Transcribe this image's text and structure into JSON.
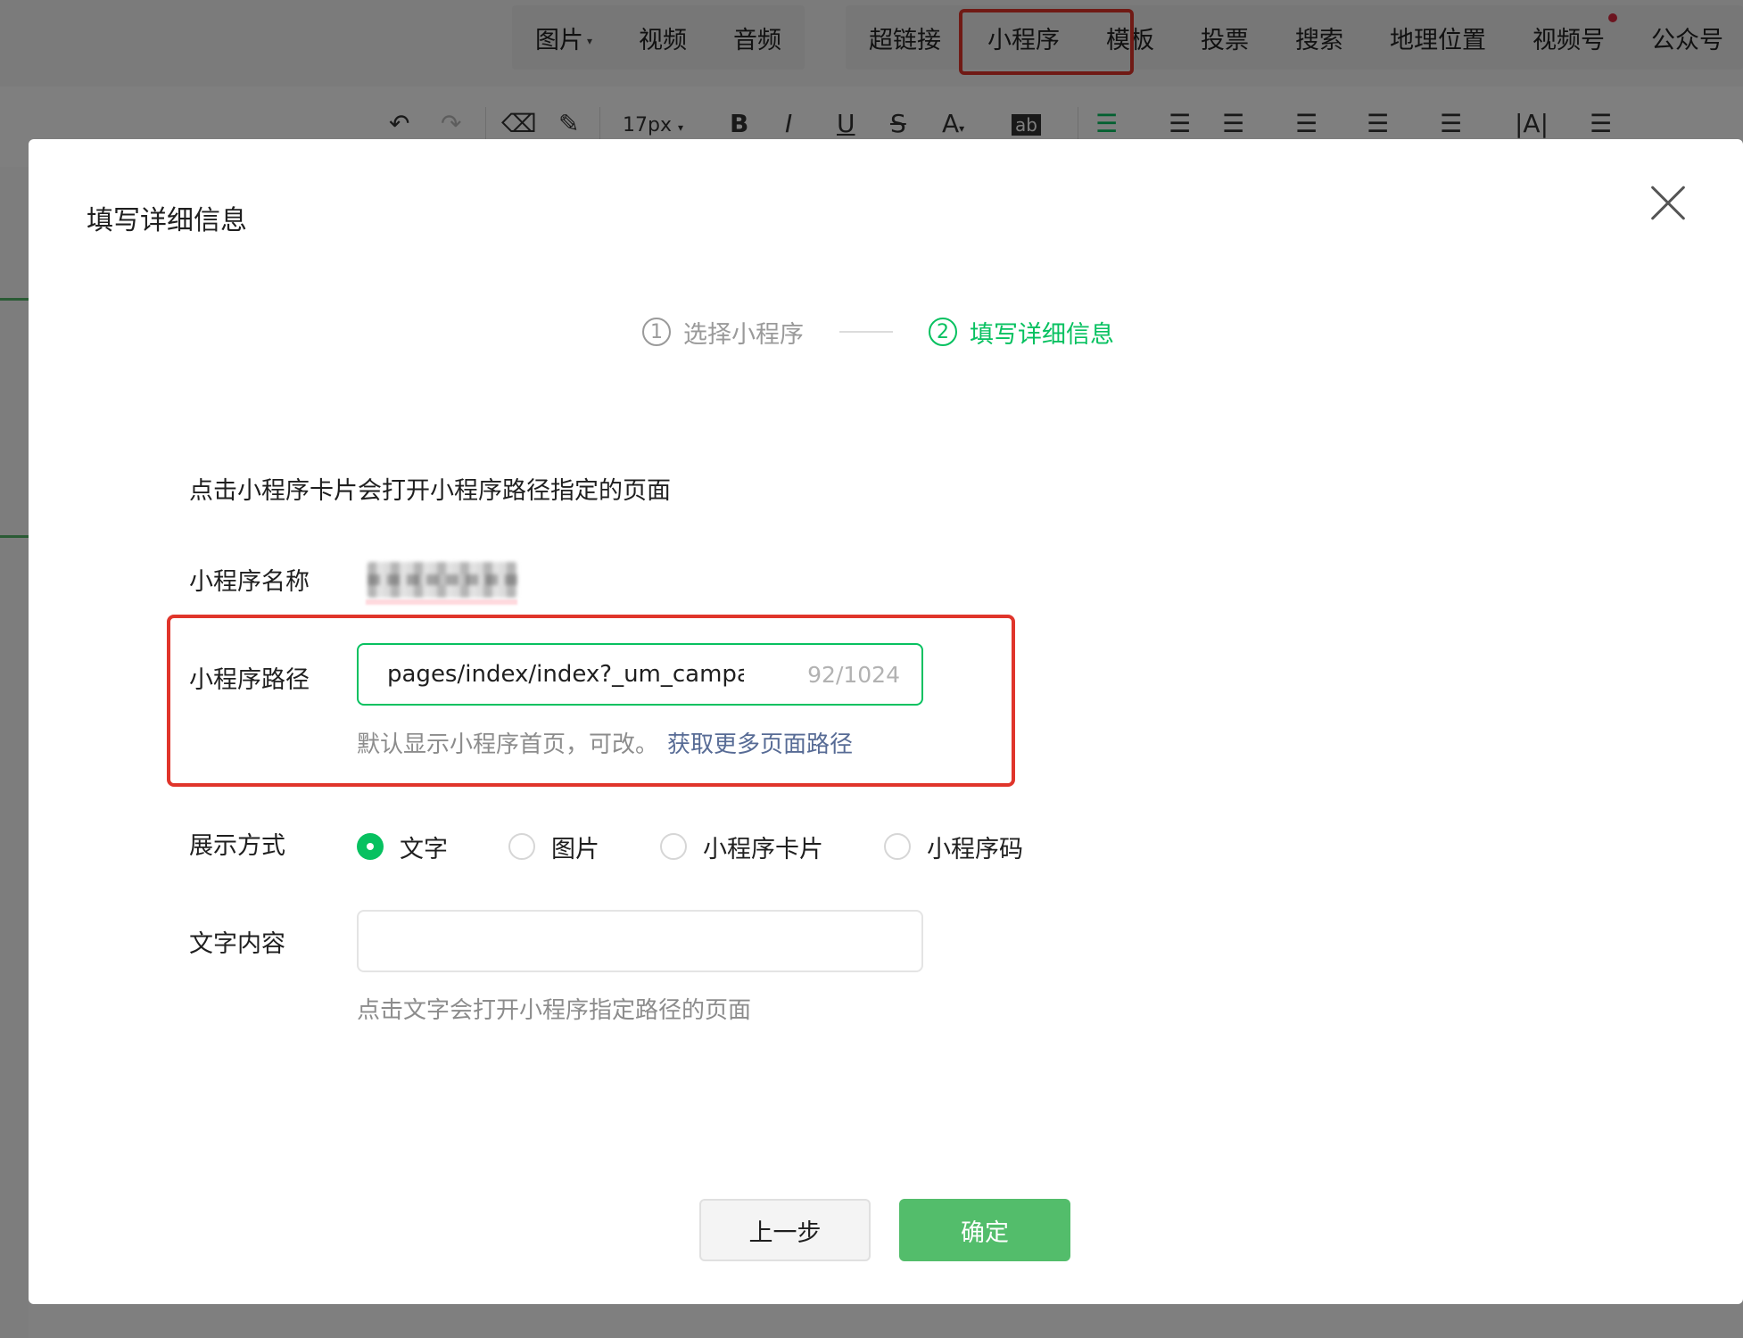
{
  "editor": {
    "insert_menu": [
      {
        "label": "图片",
        "has_caret": true
      },
      {
        "label": "视频"
      },
      {
        "label": "音频"
      }
    ],
    "insert_menu_2": [
      {
        "label": "超链接"
      },
      {
        "label": "小程序"
      },
      {
        "label": "模板"
      },
      {
        "label": "投票"
      },
      {
        "label": "搜索"
      },
      {
        "label": "地理位置"
      },
      {
        "label": "视频号"
      },
      {
        "label": "公众号"
      }
    ],
    "font_size": "17px"
  },
  "dialog": {
    "title": "填写详细信息",
    "steps": [
      {
        "num": "1",
        "label": "选择小程序",
        "active": false
      },
      {
        "num": "2",
        "label": "填写详细信息",
        "active": true
      }
    ],
    "description": "点击小程序卡片会打开小程序路径指定的页面",
    "name_label": "小程序名称",
    "path_label": "小程序路径",
    "path_value": "pages/index/index?_um_campaign",
    "path_counter": "92/1024",
    "path_hint": "默认显示小程序首页，可改。",
    "path_link": "获取更多页面路径",
    "display_label": "展示方式",
    "display_options": [
      {
        "label": "文字",
        "checked": true
      },
      {
        "label": "图片",
        "checked": false
      },
      {
        "label": "小程序卡片",
        "checked": false
      },
      {
        "label": "小程序码",
        "checked": false
      }
    ],
    "text_label": "文字内容",
    "text_value": "",
    "text_hint": "点击文字会打开小程序指定路径的页面",
    "prev_button": "上一步",
    "ok_button": "确定"
  },
  "colors": {
    "accent_green": "#07c160",
    "button_green": "#53bd6b",
    "link_blue": "#576b95",
    "highlight_red": "#e0352b"
  }
}
